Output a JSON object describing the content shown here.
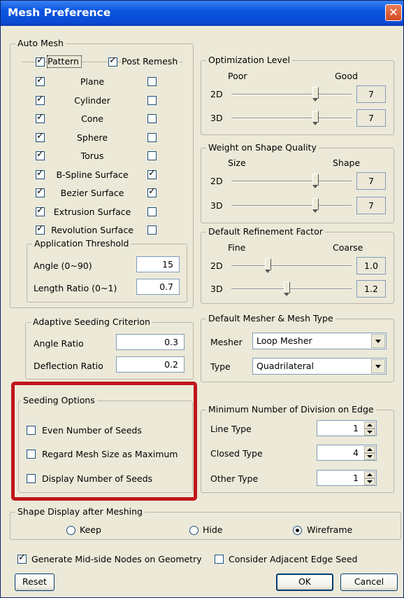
{
  "window": {
    "title": "Mesh Preference",
    "close_glyph": "✕"
  },
  "auto_mesh": {
    "title": "Auto Mesh",
    "pattern_label": "Pattern",
    "post_remesh_label": "Post Remesh",
    "rows": [
      {
        "label": "Plane",
        "pattern": true,
        "post_remesh": false
      },
      {
        "label": "Cylinder",
        "pattern": true,
        "post_remesh": false
      },
      {
        "label": "Cone",
        "pattern": true,
        "post_remesh": false
      },
      {
        "label": "Sphere",
        "pattern": true,
        "post_remesh": false
      },
      {
        "label": "Torus",
        "pattern": true,
        "post_remesh": false
      },
      {
        "label": "B-Spline Surface",
        "pattern": true,
        "post_remesh": true
      },
      {
        "label": "Bezier Surface",
        "pattern": true,
        "post_remesh": true
      },
      {
        "label": "Extrusion Surface",
        "pattern": true,
        "post_remesh": false
      },
      {
        "label": "Revolution Surface",
        "pattern": true,
        "post_remesh": false
      }
    ],
    "threshold": {
      "title": "Application Threshold",
      "angle_label": "Angle (0~90)",
      "angle_value": "15",
      "length_label": "Length Ratio (0~1)",
      "length_value": "0.7"
    }
  },
  "optimization": {
    "title": "Optimization Level",
    "low": "Poor",
    "high": "Good",
    "row2d": "2D",
    "row3d": "3D",
    "value2d": "7",
    "value3d": "7",
    "level2d": 0.7,
    "level3d": 0.7
  },
  "weight": {
    "title": "Weight on Shape Quality",
    "low": "Size",
    "high": "Shape",
    "row2d": "2D",
    "row3d": "3D",
    "value2d": "7",
    "value3d": "7",
    "level2d": 0.7,
    "level3d": 0.7
  },
  "refinement": {
    "title": "Default Refinement Factor",
    "low": "Fine",
    "high": "Coarse",
    "row2d": "2D",
    "row3d": "3D",
    "value2d": "1.0",
    "value3d": "1.2",
    "level2d": 0.3,
    "level3d": 0.46
  },
  "adaptive": {
    "title": "Adaptive Seeding Criterion",
    "angle_label": "Angle Ratio",
    "angle_value": "0.3",
    "deflection_label": "Deflection Ratio",
    "deflection_value": "0.2"
  },
  "mesher": {
    "title": "Default Mesher & Mesh Type",
    "mesher_label": "Mesher",
    "mesher_value": "Loop Mesher",
    "type_label": "Type",
    "type_value": "Quadrilateral"
  },
  "seeding": {
    "title": "Seeding Options",
    "even_label": "Even Number of Seeds",
    "even": false,
    "regard_label": "Regard Mesh Size as Maximum",
    "regard": false,
    "display_label": "Display Number of Seeds",
    "display": false
  },
  "division": {
    "title": "Minimum Number of Division on Edge",
    "line_label": "Line Type",
    "line_value": "1",
    "closed_label": "Closed Type",
    "closed_value": "4",
    "other_label": "Other Type",
    "other_value": "1"
  },
  "shape_display": {
    "title": "Shape Display after Meshing",
    "keep": "Keep",
    "hide": "Hide",
    "wireframe": "Wireframe",
    "selected": "wireframe"
  },
  "footer": {
    "midside_label": "Generate Mid-side Nodes on Geometry",
    "midside": true,
    "adjacent_label": "Consider Adjacent Edge Seed",
    "adjacent": false,
    "reset": "Reset",
    "ok": "OK",
    "cancel": "Cancel"
  },
  "colors": {
    "title_bar": "#0a4bd4",
    "highlight_box": "#c0141c",
    "dialog_bg": "#ece9d8"
  }
}
